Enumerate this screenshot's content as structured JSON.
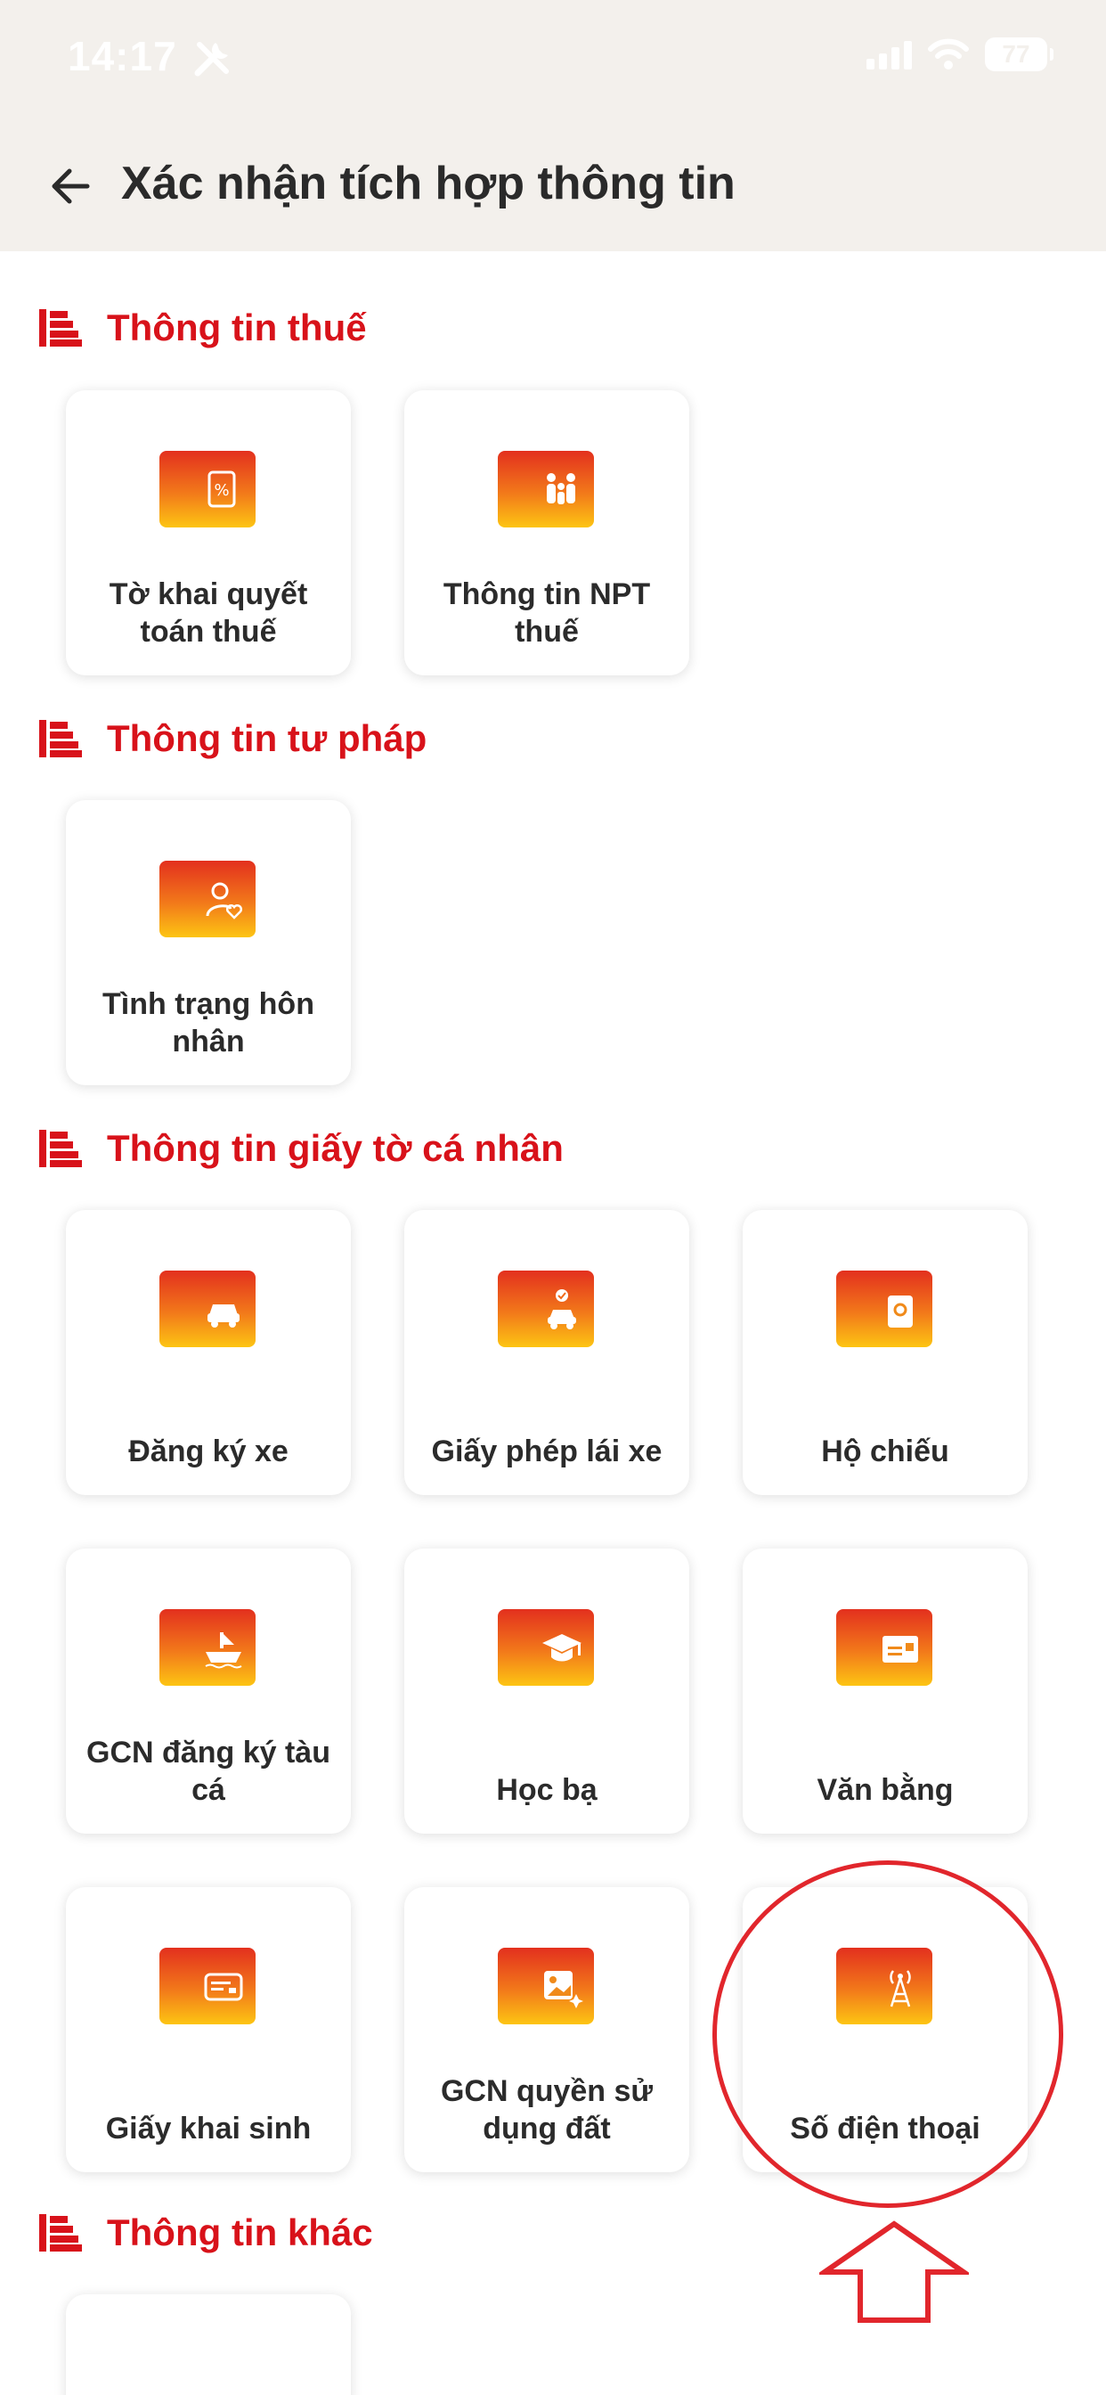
{
  "status_bar": {
    "time": "14:17",
    "battery": "77"
  },
  "header": {
    "title": "Xác nhận tích hợp thông tin"
  },
  "sections": [
    {
      "title": "Thông tin thuế"
    },
    {
      "title": "Thông tin tư pháp"
    },
    {
      "title": "Thông tin giấy tờ cá nhân"
    },
    {
      "title": "Thông tin khác"
    }
  ],
  "cards": {
    "tax_return": {
      "label": "Tờ khai quyết toán thuế",
      "icon": "receipt-icon"
    },
    "npt": {
      "label": "Thông tin NPT thuế",
      "icon": "family-icon"
    },
    "marital": {
      "label": "Tình trạng hôn nhân",
      "icon": "person-heart-icon"
    },
    "vehicle_reg": {
      "label": "Đăng ký xe",
      "icon": "car-icon"
    },
    "driver_license": {
      "label": "Giấy phép lái xe",
      "icon": "car-check-icon"
    },
    "passport": {
      "label": "Hộ chiếu",
      "icon": "passport-icon"
    },
    "fishing_boat": {
      "label": "GCN đăng ký tàu cá",
      "icon": "ship-icon"
    },
    "school_record": {
      "label": "Học bạ",
      "icon": "graduation-cap-icon"
    },
    "diploma": {
      "label": "Văn bằng",
      "icon": "certificate-icon"
    },
    "birth_cert": {
      "label": "Giấy khai sinh",
      "icon": "id-card-icon"
    },
    "land_use": {
      "label": "GCN quyền sử dụng đất",
      "icon": "land-photo-icon"
    },
    "phone": {
      "label": "Số điện thoại",
      "icon": "antenna-tower-icon"
    }
  },
  "colors": {
    "accent_red": "#d8121a",
    "header_bg": "#f3f0ec",
    "icon_gradient_top": "#e3301e",
    "icon_gradient_bottom": "#fdc513",
    "annotation_red": "#e1262c"
  }
}
